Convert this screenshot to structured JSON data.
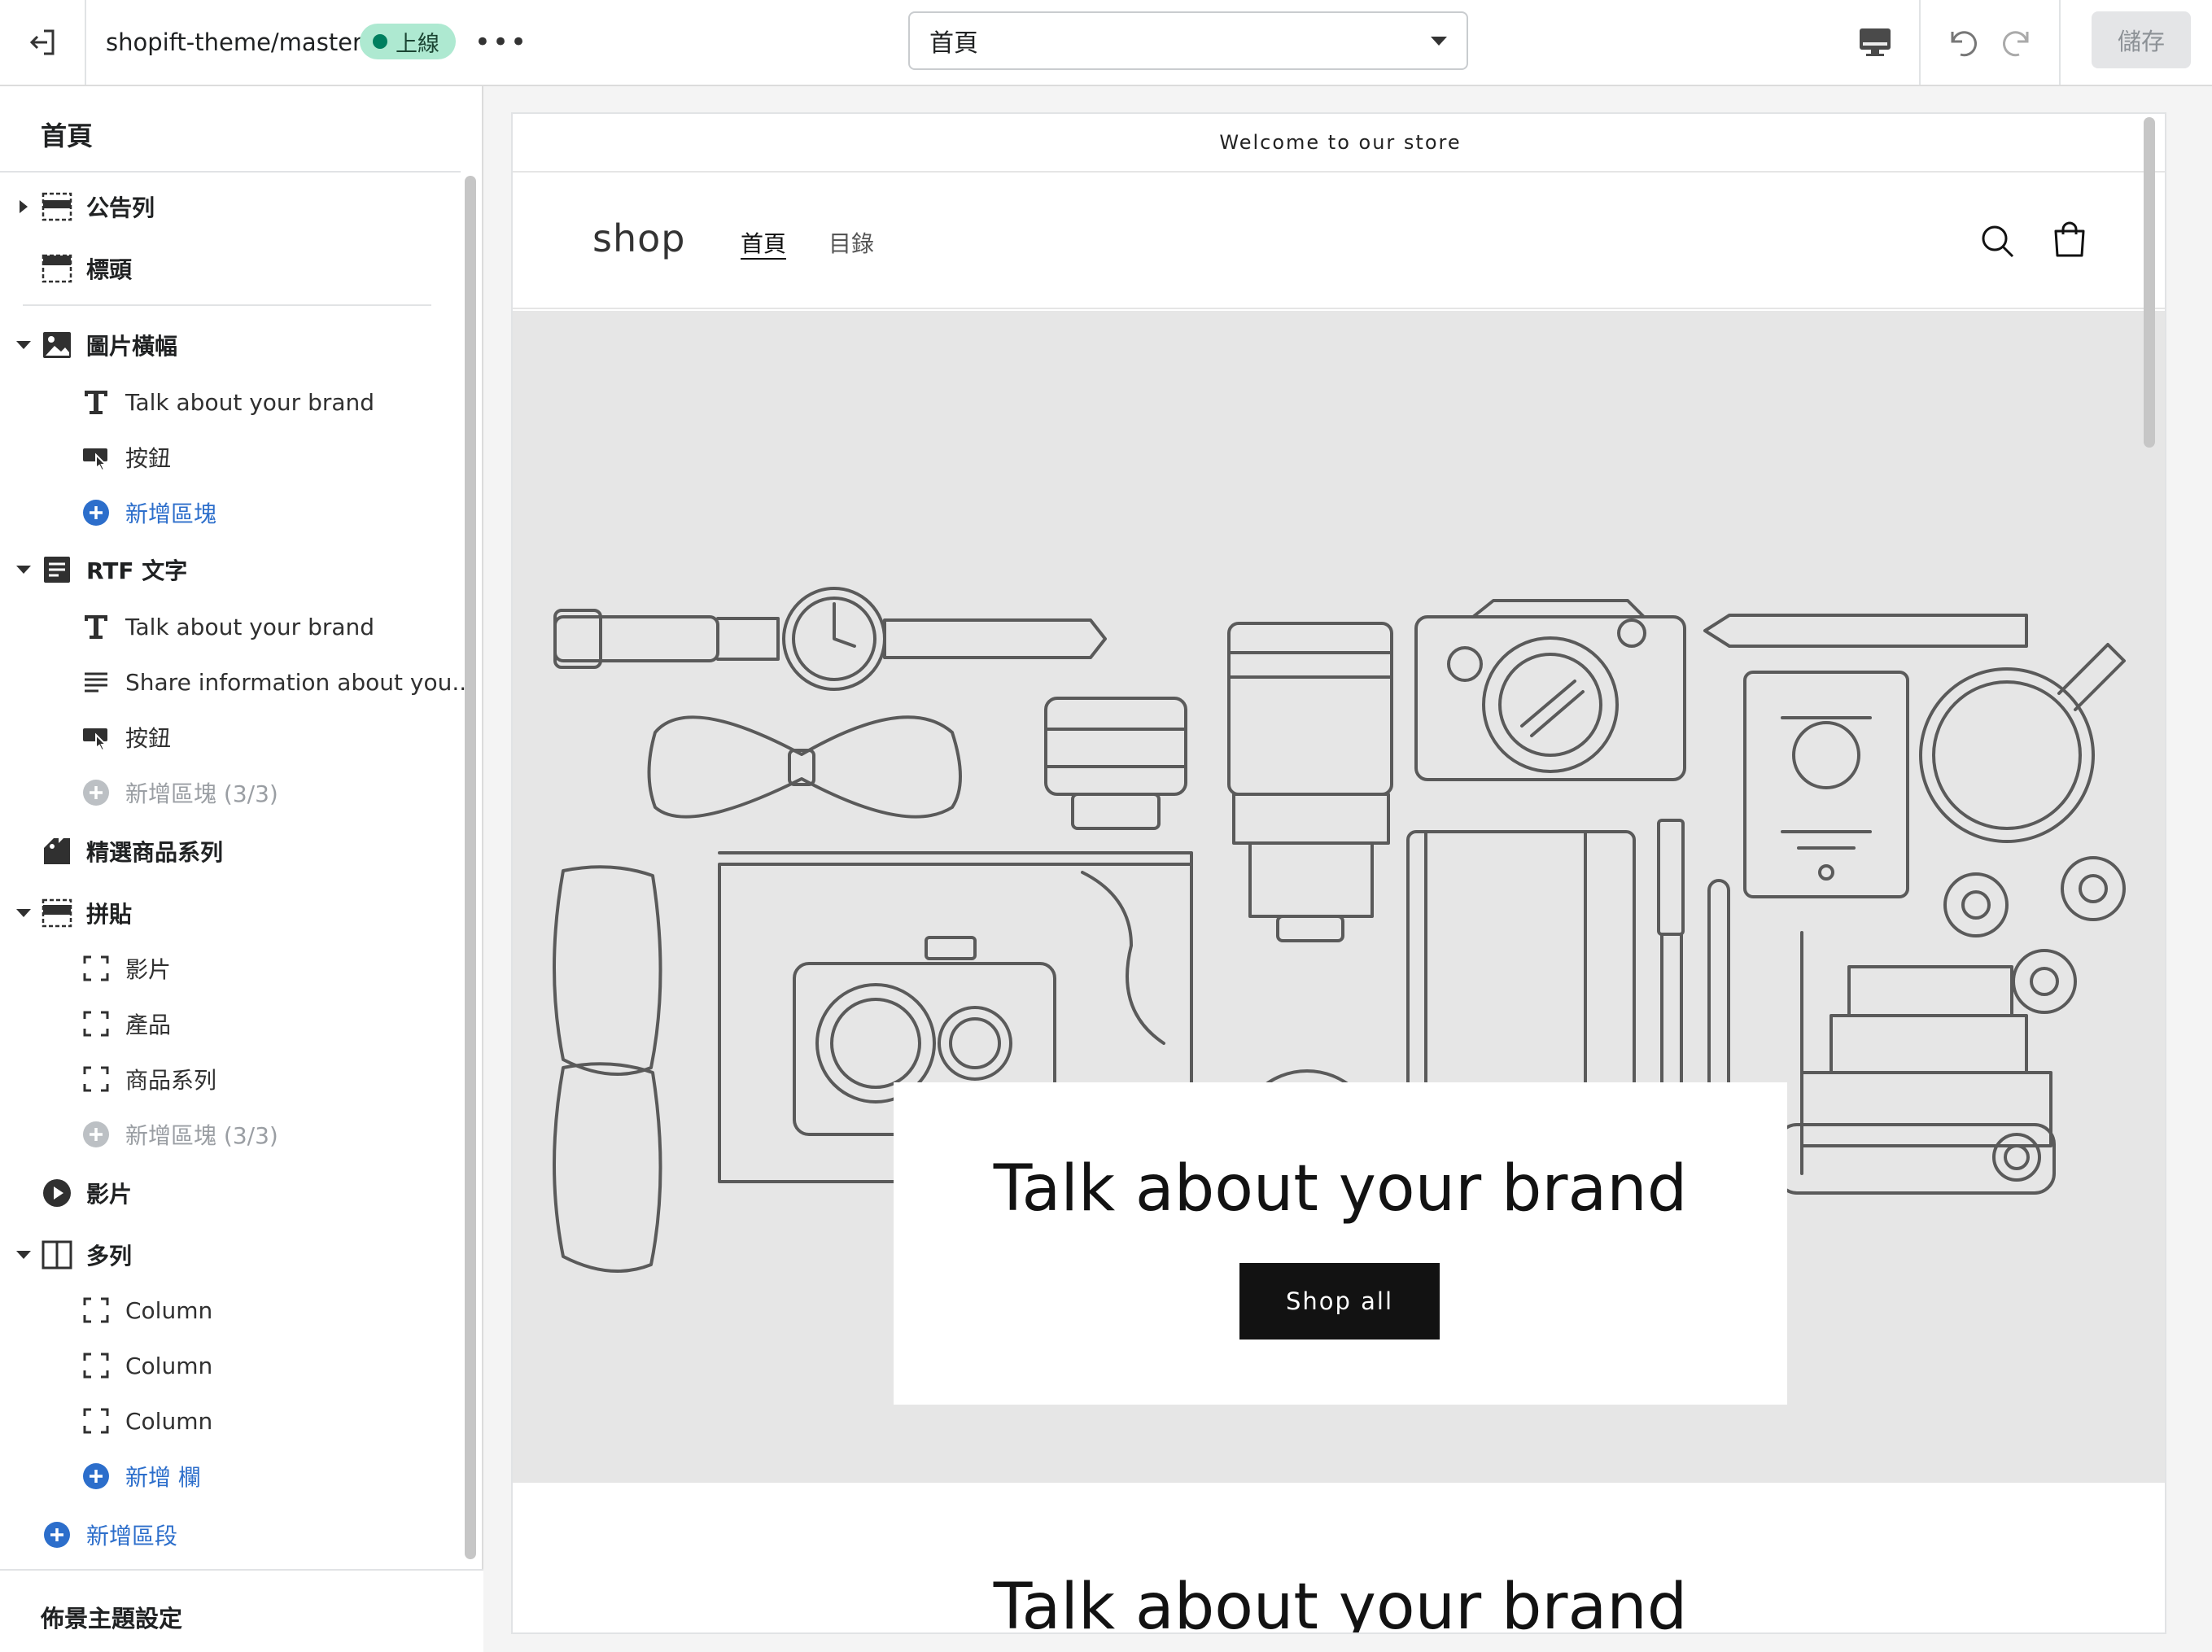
{
  "topbar": {
    "theme_name": "shopift-theme/master",
    "status_label": "上線",
    "more_label": "•••",
    "page_select_value": "首頁",
    "save_label": "儲存"
  },
  "sidebar": {
    "title": "首頁",
    "rows": [
      {
        "id": "sec-announcement",
        "kind": "sec",
        "arrow": "right",
        "icon": "announcement-bar-icon",
        "label": "公告列"
      },
      {
        "id": "sec-header",
        "kind": "sec",
        "arrow": "",
        "icon": "header-icon",
        "label": "標頭"
      },
      {
        "id": "sec-image-banner",
        "kind": "sec",
        "arrow": "down",
        "icon": "image-icon",
        "label": "圖片橫幅"
      },
      {
        "id": "blk-heading-1",
        "kind": "blk",
        "icon": "text-icon",
        "label": "Talk about your brand"
      },
      {
        "id": "blk-button-1",
        "kind": "blk",
        "icon": "button-icon",
        "label": "按鈕"
      },
      {
        "id": "add-block-1",
        "kind": "blk",
        "icon": "add-circle-icon",
        "label": "新增區塊",
        "style": "blue"
      },
      {
        "id": "sec-rich-text",
        "kind": "sec",
        "arrow": "down",
        "icon": "rich-text-icon",
        "label": "RTF 文字"
      },
      {
        "id": "blk-heading-2",
        "kind": "blk",
        "icon": "text-icon",
        "label": "Talk about your brand"
      },
      {
        "id": "blk-text-2",
        "kind": "blk",
        "icon": "paragraph-icon",
        "label": "Share information about you..."
      },
      {
        "id": "blk-button-2",
        "kind": "blk",
        "icon": "button-icon",
        "label": "按鈕"
      },
      {
        "id": "add-block-2",
        "kind": "blk",
        "icon": "add-circle-icon",
        "label": "新增區塊 (3/3)",
        "style": "gray"
      },
      {
        "id": "sec-featured-collection",
        "kind": "sec",
        "arrow": "",
        "icon": "collection-tag-icon",
        "label": "精選商品系列"
      },
      {
        "id": "sec-collage",
        "kind": "sec",
        "arrow": "down",
        "icon": "collage-icon",
        "label": "拼貼"
      },
      {
        "id": "blk-video",
        "kind": "blk",
        "icon": "block-frame-icon",
        "label": "影片"
      },
      {
        "id": "blk-product",
        "kind": "blk",
        "icon": "block-frame-icon",
        "label": "產品"
      },
      {
        "id": "blk-collection",
        "kind": "blk",
        "icon": "block-frame-icon",
        "label": "商品系列"
      },
      {
        "id": "add-block-3",
        "kind": "blk",
        "icon": "add-circle-icon",
        "label": "新增區塊 (3/3)",
        "style": "gray"
      },
      {
        "id": "sec-video",
        "kind": "sec",
        "arrow": "",
        "icon": "play-circle-icon",
        "label": "影片"
      },
      {
        "id": "sec-multicolumn",
        "kind": "sec",
        "arrow": "down",
        "icon": "columns-icon",
        "label": "多列"
      },
      {
        "id": "blk-column-1",
        "kind": "blk",
        "icon": "block-frame-icon",
        "label": "Column"
      },
      {
        "id": "blk-column-2",
        "kind": "blk",
        "icon": "block-frame-icon",
        "label": "Column"
      },
      {
        "id": "blk-column-3",
        "kind": "blk",
        "icon": "block-frame-icon",
        "label": "Column"
      },
      {
        "id": "add-column",
        "kind": "blk",
        "icon": "add-circle-icon",
        "label": "新增 欄",
        "style": "blue"
      },
      {
        "id": "add-section",
        "kind": "sec",
        "arrow": "",
        "icon": "add-circle-icon",
        "label": "新增區段",
        "style": "blue"
      }
    ],
    "footer_label": "佈景主題設定"
  },
  "preview": {
    "announcement": "Welcome to our store",
    "logo": "shop",
    "nav": [
      "首頁",
      "目錄"
    ],
    "banner_heading": "Talk about your brand",
    "banner_button": "Shop all",
    "rich_text_heading": "Talk about your brand"
  },
  "colors": {
    "accent_blue": "#2c6ecb",
    "status_badge_bg": "#aee9d1",
    "status_dot": "#007f5f",
    "banner_bg": "#e6e6e6",
    "button_dark": "#121212"
  }
}
